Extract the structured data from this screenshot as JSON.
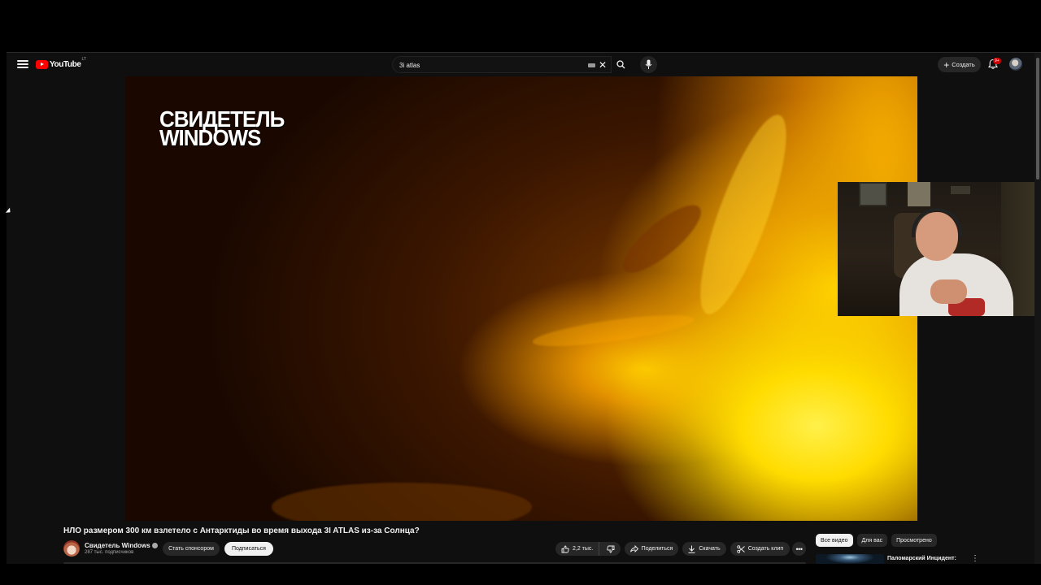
{
  "masthead": {
    "logo_text": "YouTube",
    "logo_region": "LT",
    "search_value": "3i atlas",
    "create_label": "Создать",
    "notif_badge": "9+"
  },
  "video": {
    "watermark": "СВИДЕТЕЛЬ WINDOWS",
    "title": "НЛО размером 300 км взлетело с Антарктиды во время выхода 3I ATLAS из-за Солнца?"
  },
  "channel": {
    "name": "Свидетель Windows",
    "subscribers": "287 тыс. подписчиков",
    "sponsor_label": "Стать спонсором",
    "subscribe_label": "Подписаться"
  },
  "actions": {
    "likes": "2,2 тыс.",
    "share_label": "Поделиться",
    "download_label": "Скачать",
    "clip_label": "Создать клип",
    "more_label": "•••"
  },
  "sidebar": {
    "chips": [
      "Все видео",
      "Для вас",
      "Просмотрено"
    ],
    "rec_title": "Паломарский Инцидент:"
  },
  "colors": {
    "background": "#0f0f0f",
    "brand_red": "#ff0000",
    "pill": "#272727",
    "text": "#f1f1f1"
  },
  "icons": [
    "menu-icon",
    "search-icon",
    "mic-icon",
    "keyboard-icon",
    "close-icon",
    "plus-icon",
    "bell-icon",
    "like-icon",
    "dislike-icon",
    "share-icon",
    "download-icon",
    "scissors-icon",
    "more-icon"
  ]
}
